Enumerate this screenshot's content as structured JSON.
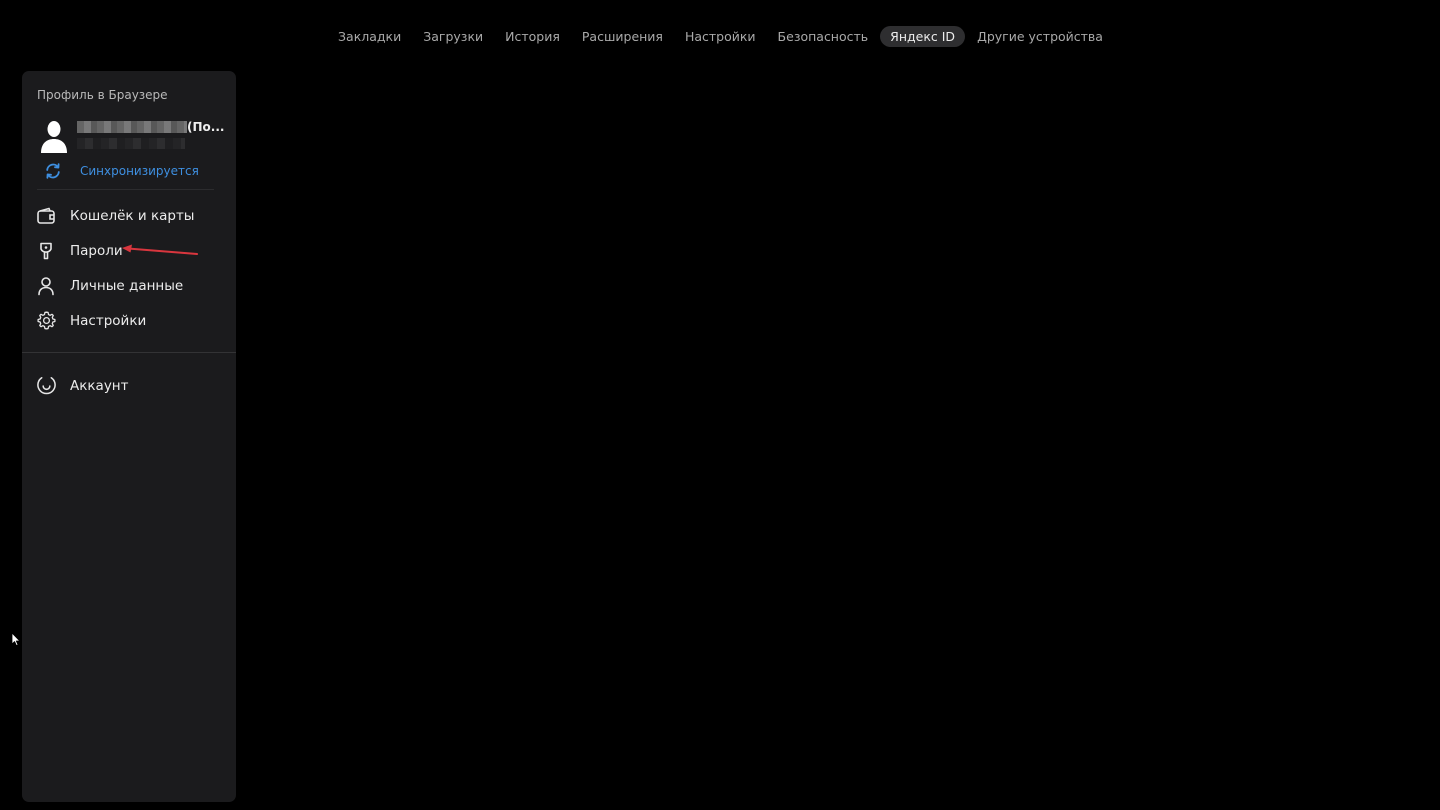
{
  "topnav": {
    "tabs": [
      {
        "label": "Закладки",
        "active": false
      },
      {
        "label": "Загрузки",
        "active": false
      },
      {
        "label": "История",
        "active": false
      },
      {
        "label": "Расширения",
        "active": false
      },
      {
        "label": "Настройки",
        "active": false
      },
      {
        "label": "Безопасность",
        "active": false
      },
      {
        "label": "Яндекс ID",
        "active": true
      },
      {
        "label": "Другие устройства",
        "active": false
      }
    ]
  },
  "sidebar": {
    "profile_caption": "Профиль в Браузере",
    "profile_name_suffix": "(По...",
    "sync_status": "Синхронизируется",
    "items": [
      {
        "label": "Кошелёк и карты",
        "icon": "wallet-icon"
      },
      {
        "label": "Пароли",
        "icon": "key-icon"
      },
      {
        "label": "Личные данные",
        "icon": "person-icon"
      },
      {
        "label": "Настройки",
        "icon": "gear-icon"
      }
    ],
    "account": {
      "label": "Аккаунт",
      "icon": "account-icon"
    }
  },
  "colors": {
    "background": "#000000",
    "sidebar_bg": "#1b1b1d",
    "active_tab_bg": "#2e2e30",
    "sync_blue": "#3e8fe0",
    "annotation_red": "#d9363e"
  }
}
